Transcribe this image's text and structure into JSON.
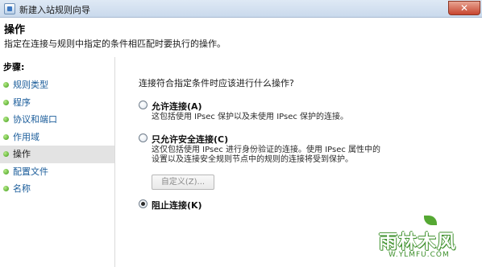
{
  "window": {
    "title": "新建入站规则向导",
    "close_glyph": "✕"
  },
  "header": {
    "title": "操作",
    "description": "指定在连接与规则中指定的条件相匹配时要执行的操作。"
  },
  "steps": {
    "heading": "步骤:",
    "items": [
      {
        "label": "规则类型",
        "active": false
      },
      {
        "label": "程序",
        "active": false
      },
      {
        "label": "协议和端口",
        "active": false
      },
      {
        "label": "作用域",
        "active": false
      },
      {
        "label": "操作",
        "active": true
      },
      {
        "label": "配置文件",
        "active": false
      },
      {
        "label": "名称",
        "active": false
      }
    ]
  },
  "main": {
    "question": "连接符合指定条件时应该进行什么操作?",
    "options": [
      {
        "label": "允许连接(A)",
        "description": "这包括使用 IPsec 保护以及未使用 IPsec 保护的连接。",
        "selected": false
      },
      {
        "label": "只允许安全连接(C)",
        "description": "这仅包括使用 IPsec 进行身份验证的连接。使用 IPsec 属性中的设置以及连接安全规则节点中的规则的连接将受到保护。",
        "selected": false
      },
      {
        "label": "阻止连接(K)",
        "description": "",
        "selected": true
      }
    ],
    "customize_button": "自定义(Z)..."
  },
  "watermark": {
    "brand": "雨林木风",
    "url": "W.YLMFU.COM"
  },
  "colors": {
    "titlebar": "#c9d9ec",
    "step_link": "#1a5c9a",
    "step_active_bg": "#e3e3e3",
    "step_bullet": "#3f9b17",
    "close_button": "#c7452f"
  }
}
